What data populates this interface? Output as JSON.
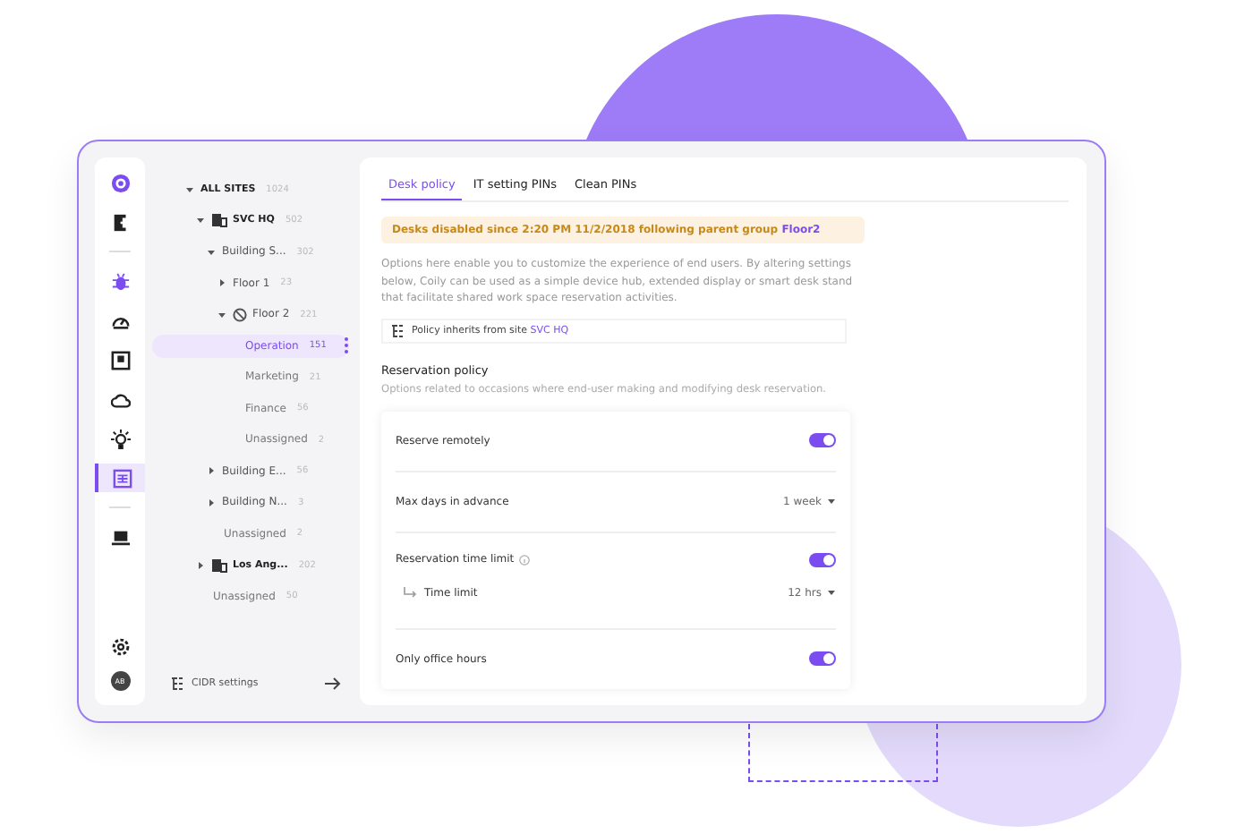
{
  "rail": [
    {
      "selected": false
    },
    {
      "selected": false
    },
    {
      "selected": false
    },
    {
      "selected": false
    },
    {
      "selected": false
    },
    {
      "selected": false
    },
    {
      "selected": false
    },
    {
      "selected": true
    },
    {
      "selected": false
    }
  ],
  "avatar": "AB",
  "tree": [
    {
      "label": "ALL SITES",
      "count": "1024",
      "kind": "root",
      "expanded": true,
      "selected": false,
      "children": [
        {
          "label": "SVC HQ",
          "count": "502",
          "kind": "site",
          "expanded": true,
          "selected": false,
          "children": [
            {
              "label": "Building S...",
              "count": "302",
              "kind": "group",
              "expanded": true,
              "selected": false,
              "children": [
                {
                  "label": "Floor 1",
                  "count": "23",
                  "kind": "group",
                  "expanded": false,
                  "selected": false
                },
                {
                  "label": "Floor 2",
                  "count": "221",
                  "kind": "group",
                  "expanded": true,
                  "disabled": true,
                  "selected": false,
                  "children": [
                    {
                      "label": "Operation",
                      "count": "151",
                      "kind": "leaf",
                      "selected": true
                    },
                    {
                      "label": "Marketing",
                      "count": "21",
                      "kind": "leaf",
                      "selected": false
                    },
                    {
                      "label": "Finance",
                      "count": "56",
                      "kind": "leaf",
                      "selected": false
                    },
                    {
                      "label": "Unassigned",
                      "count": "2",
                      "kind": "leaf",
                      "selected": false
                    }
                  ]
                }
              ]
            },
            {
              "label": "Building E...",
              "count": "56",
              "kind": "group",
              "expanded": false,
              "selected": false
            },
            {
              "label": "Building N...",
              "count": "3",
              "kind": "group",
              "expanded": false,
              "selected": false
            },
            {
              "label": "Unassigned",
              "count": "2",
              "kind": "leaf",
              "selected": false
            }
          ]
        },
        {
          "label": "Los Ang...",
          "count": "202",
          "kind": "site",
          "expanded": false,
          "selected": false
        },
        {
          "label": "Unassigned",
          "count": "50",
          "kind": "leaf",
          "selected": false
        }
      ]
    }
  ],
  "tree_footer": {
    "label": "CIDR settings"
  },
  "tabs": [
    {
      "label": "Desk policy",
      "selected": true
    },
    {
      "label": "IT setting PINs",
      "selected": false
    },
    {
      "label": "Clean PINs",
      "selected": false
    }
  ],
  "alert": {
    "text": "Desks disabled since 2:20 PM 11/2/2018 following parent group",
    "link": "Floor2"
  },
  "intro": "Options here enable you to customize the experience of end users. By altering settings below, Coily can be used as a simple device hub, extended display or smart desk stand that facilitate shared work space reservation activities.",
  "inherit": {
    "text": "Policy inherits from site",
    "link": "SVC HQ"
  },
  "section": {
    "title": "Reservation policy",
    "description": "Options related to occasions where end-user making and modifying desk reservation."
  },
  "settings": [
    {
      "kind": "toggle",
      "label": "Reserve remotely",
      "on": true
    },
    {
      "kind": "select",
      "label": "Max days in advance",
      "value": "1 week"
    },
    {
      "kind": "toggle",
      "label": "Reservation time limit",
      "on": true,
      "info": true
    },
    {
      "kind": "subselect",
      "label": "Time limit",
      "value": "12 hrs"
    },
    {
      "kind": "toggle",
      "label": "Only office hours",
      "on": true
    }
  ]
}
